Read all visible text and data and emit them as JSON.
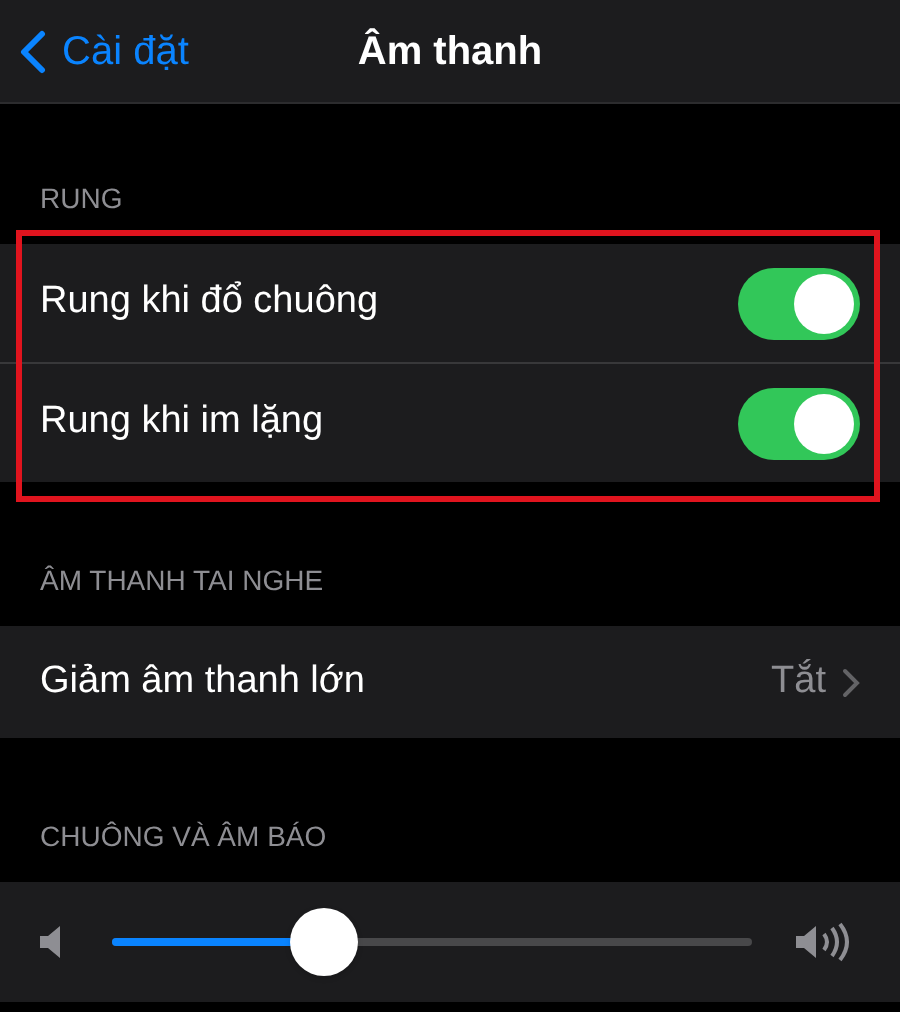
{
  "nav_bar": {
    "back_label": "Cài đặt",
    "title": "Âm thanh"
  },
  "sections": [
    {
      "header": "RUNG",
      "highlighted": true,
      "rows": [
        {
          "kind": "toggle",
          "label": "Rung khi đổ chuông",
          "on": true
        },
        {
          "kind": "toggle",
          "label": "Rung khi im lặng",
          "on": true
        }
      ]
    },
    {
      "header": "ÂM THANH TAI NGHE",
      "highlighted": false,
      "rows": [
        {
          "kind": "link",
          "label": "Giảm âm thanh lớn",
          "value": "Tắt"
        }
      ]
    },
    {
      "header": "CHUÔNG VÀ ÂM BÁO",
      "highlighted": false,
      "rows": [
        {
          "kind": "slider",
          "level": 0.33
        }
      ]
    }
  ]
}
